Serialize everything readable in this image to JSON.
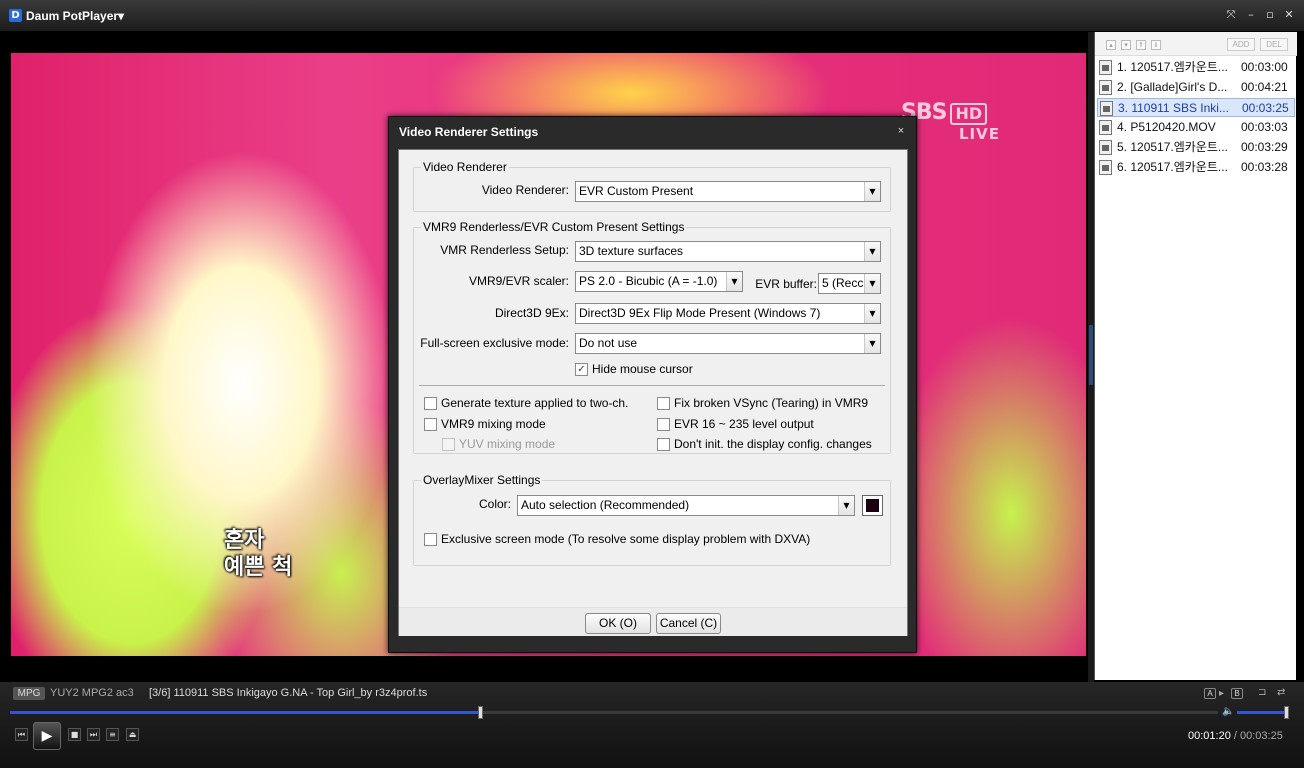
{
  "app": {
    "logo": "D",
    "title": "Daum PotPlayer▾"
  },
  "window_controls": {
    "expand": "⤧",
    "minimize": "–",
    "maximize": "▫",
    "close": "✕"
  },
  "video": {
    "subtitle_line1": "혼자",
    "subtitle_line2": "예쁜 척",
    "broadcast_logo": {
      "name": "SBS",
      "badge": "HD",
      "sub": "LIVE"
    }
  },
  "playlist": {
    "toolbar": {
      "up": "▴",
      "down": "▾",
      "top": "⇑",
      "bottom": "⇓",
      "add": "ADD",
      "del": "DEL"
    },
    "items": [
      {
        "name": "1. 120517.엠카운트...",
        "duration": "00:03:00",
        "selected": false
      },
      {
        "name": "2. [Gallade]Girl's D...",
        "duration": "00:04:21",
        "selected": false
      },
      {
        "name": "3. 110911 SBS Inki...",
        "duration": "00:03:25",
        "selected": true
      },
      {
        "name": "4. P5120420.MOV",
        "duration": "00:03:03",
        "selected": false
      },
      {
        "name": "5. 120517.엠카운트...",
        "duration": "00:03:29",
        "selected": false
      },
      {
        "name": "6. 120517.엠카운트...",
        "duration": "00:03:28",
        "selected": false
      }
    ]
  },
  "status": {
    "codec_badge": "MPG",
    "codecs": "YUY2  MPG2    ac3",
    "now_playing": "[3/6] 110911 SBS Inkigayo G.NA - Top Girl_by r3z4prof.ts",
    "ab_a": "A",
    "ab_b": "B",
    "ab_arrow": "▸",
    "extra_icon_1": "⊐",
    "extra_icon_2": "⇄"
  },
  "seek": {
    "progress": 0.39
  },
  "volume": {
    "level": 0.97,
    "icon": "🔈"
  },
  "controls": {
    "prev": "⏮",
    "play": "▶",
    "stop": "■",
    "next": "⏭",
    "playlist": "≡",
    "eject": "⏏"
  },
  "time": {
    "current": "00:01:20",
    "separator": "/",
    "total": "00:03:25"
  },
  "dialog": {
    "title": "Video Renderer Settings",
    "close": "×",
    "group_renderer": {
      "legend": "Video Renderer",
      "renderer_label": "Video Renderer:",
      "renderer_value": "EVR Custom Present"
    },
    "group_vmr": {
      "legend": "VMR9 Renderless/EVR Custom Present Settings",
      "setup_label": "VMR Renderless Setup:",
      "setup_value": "3D texture surfaces",
      "scaler_label": "VMR9/EVR scaler:",
      "scaler_value": "PS 2.0 - Bicubic (A = -1.0)",
      "buffer_label": "EVR buffer:",
      "buffer_value": "5 (Recc",
      "d3d9ex_label": "Direct3D 9Ex:",
      "d3d9ex_value": "Direct3D 9Ex Flip Mode Present (Windows 7)",
      "fse_label": "Full-screen exclusive mode:",
      "fse_value": "Do not use",
      "hide_cursor": {
        "label": "Hide mouse cursor",
        "checked": true
      },
      "gen_texture": {
        "label": "Generate texture applied to two-ch.",
        "checked": false
      },
      "vmr9_mixing": {
        "label": "VMR9 mixing mode",
        "checked": false
      },
      "yuv_mixing": {
        "label": "YUV mixing mode",
        "checked": false,
        "disabled": true
      },
      "fix_vsync": {
        "label": "Fix broken VSync (Tearing) in VMR9",
        "checked": false
      },
      "evr_level": {
        "label": "EVR 16 ~ 235 level output",
        "checked": false
      },
      "no_init": {
        "label": "Don't init. the display config. changes",
        "checked": false
      }
    },
    "group_overlay": {
      "legend": "OverlayMixer Settings",
      "color_label": "Color:",
      "color_value": "Auto selection (Recommended)",
      "color_swatch": "#1a0010",
      "exclusive": {
        "label": "Exclusive screen mode (To resolve some display problem with DXVA)",
        "checked": false
      }
    },
    "ok_label": "OK (O)",
    "cancel_label": "Cancel (C)"
  },
  "combo_arrow": "▼",
  "check_mark": "✓"
}
